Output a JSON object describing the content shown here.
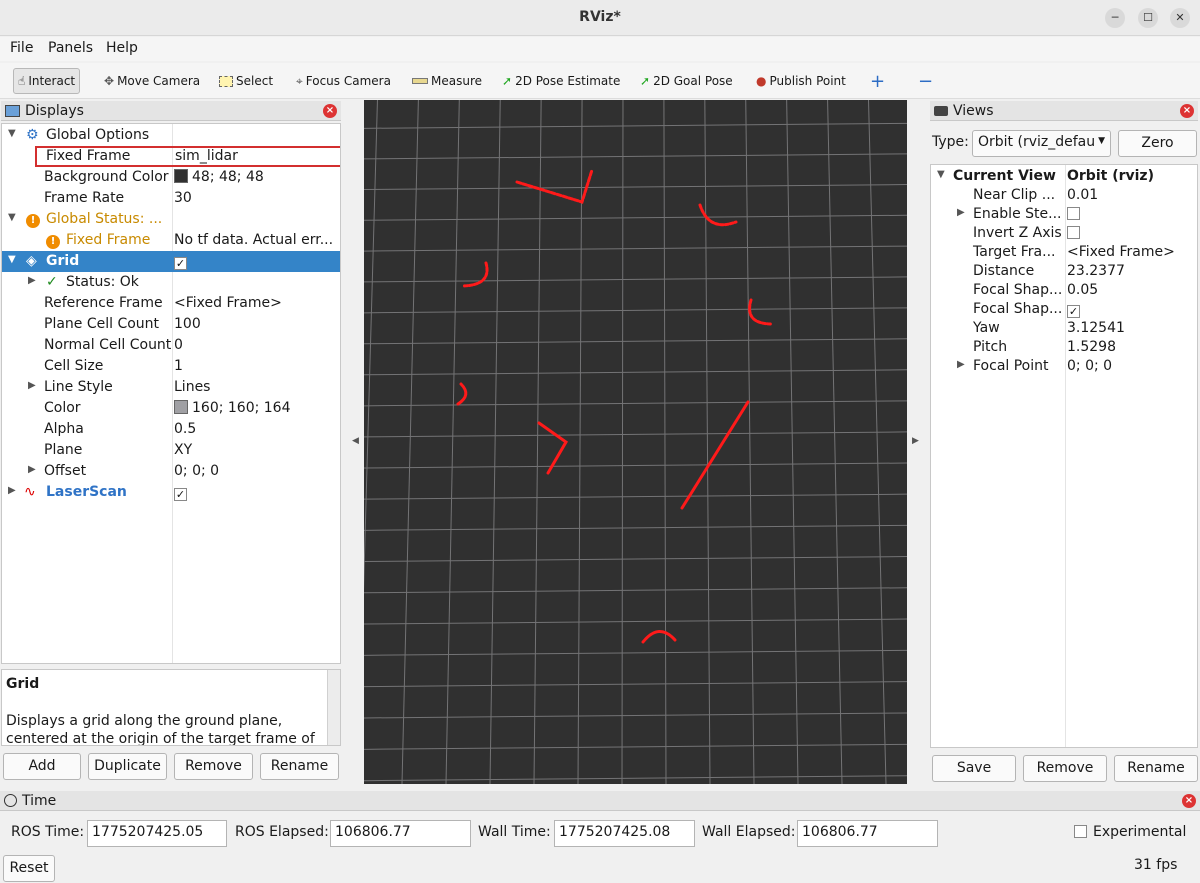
{
  "window": {
    "title": "RViz*"
  },
  "menu": {
    "file": "File",
    "panels": "Panels",
    "help": "Help"
  },
  "toolbar": {
    "interact": "Interact",
    "move_camera": "Move Camera",
    "select": "Select",
    "focus_camera": "Focus Camera",
    "measure": "Measure",
    "pose_estimate": "2D Pose Estimate",
    "goal_pose": "2D Goal Pose",
    "publish_point": "Publish Point"
  },
  "displays": {
    "title": "Displays",
    "rows": {
      "global_options": "Global Options",
      "fixed_frame_k": "Fixed Frame",
      "fixed_frame_v": "sim_lidar",
      "bg_color_k": "Background Color",
      "bg_color_v": "48; 48; 48",
      "frame_rate_k": "Frame Rate",
      "frame_rate_v": "30",
      "global_status": "Global Status: ...",
      "gs_fixed_frame_k": "Fixed Frame",
      "gs_fixed_frame_v": "No tf data.  Actual err...",
      "grid": "Grid",
      "status_k": "Status: Ok",
      "ref_frame_k": "Reference Frame",
      "ref_frame_v": "<Fixed Frame>",
      "plane_cell_k": "Plane Cell Count",
      "plane_cell_v": "100",
      "normal_cell_k": "Normal Cell Count",
      "normal_cell_v": "0",
      "cell_size_k": "Cell Size",
      "cell_size_v": "1",
      "line_style_k": "Line Style",
      "line_style_v": "Lines",
      "color_k": "Color",
      "color_v": "160; 160; 164",
      "alpha_k": "Alpha",
      "alpha_v": "0.5",
      "plane_k": "Plane",
      "plane_v": "XY",
      "offset_k": "Offset",
      "offset_v": "0; 0; 0",
      "laserscan": "LaserScan"
    },
    "description_title": "Grid",
    "description_text": "Displays a grid along the ground plane, centered at the origin of the target frame of",
    "buttons": {
      "add": "Add",
      "duplicate": "Duplicate",
      "remove": "Remove",
      "rename": "Rename"
    }
  },
  "views": {
    "title": "Views",
    "type_label": "Type:",
    "type_value": "Orbit (rviz_defau",
    "zero": "Zero",
    "rows": {
      "current_view_k": "Current View",
      "current_view_v": "Orbit (rviz)",
      "near_clip_k": "Near Clip ...",
      "near_clip_v": "0.01",
      "enable_stereo_k": "Enable Ste...",
      "invert_z_k": "Invert Z Axis",
      "target_frame_k": "Target Fra...",
      "target_frame_v": "<Fixed Frame>",
      "distance_k": "Distance",
      "distance_v": "23.2377",
      "focal_shape1_k": "Focal Shap...",
      "focal_shape1_v": "0.05",
      "focal_shape2_k": "Focal Shap...",
      "yaw_k": "Yaw",
      "yaw_v": "3.12541",
      "pitch_k": "Pitch",
      "pitch_v": "1.5298",
      "focal_point_k": "Focal Point",
      "focal_point_v": "0; 0; 0"
    },
    "buttons": {
      "save": "Save",
      "remove": "Remove",
      "rename": "Rename"
    }
  },
  "time": {
    "title": "Time",
    "ros_time_label": "ROS Time:",
    "ros_time": "1775207425.05",
    "ros_elapsed_label": "ROS Elapsed:",
    "ros_elapsed": "106806.77",
    "wall_time_label": "Wall Time:",
    "wall_time": "1775207425.08",
    "wall_elapsed_label": "Wall Elapsed:",
    "wall_elapsed": "106806.77",
    "experimental": "Experimental",
    "reset": "Reset",
    "fps": "31 fps"
  },
  "colors": {
    "background": "#303030",
    "grid": "#a0a0a4",
    "laser": "#ff0000",
    "selection": "#3484c8",
    "highlight_border": "#d32f2f"
  }
}
